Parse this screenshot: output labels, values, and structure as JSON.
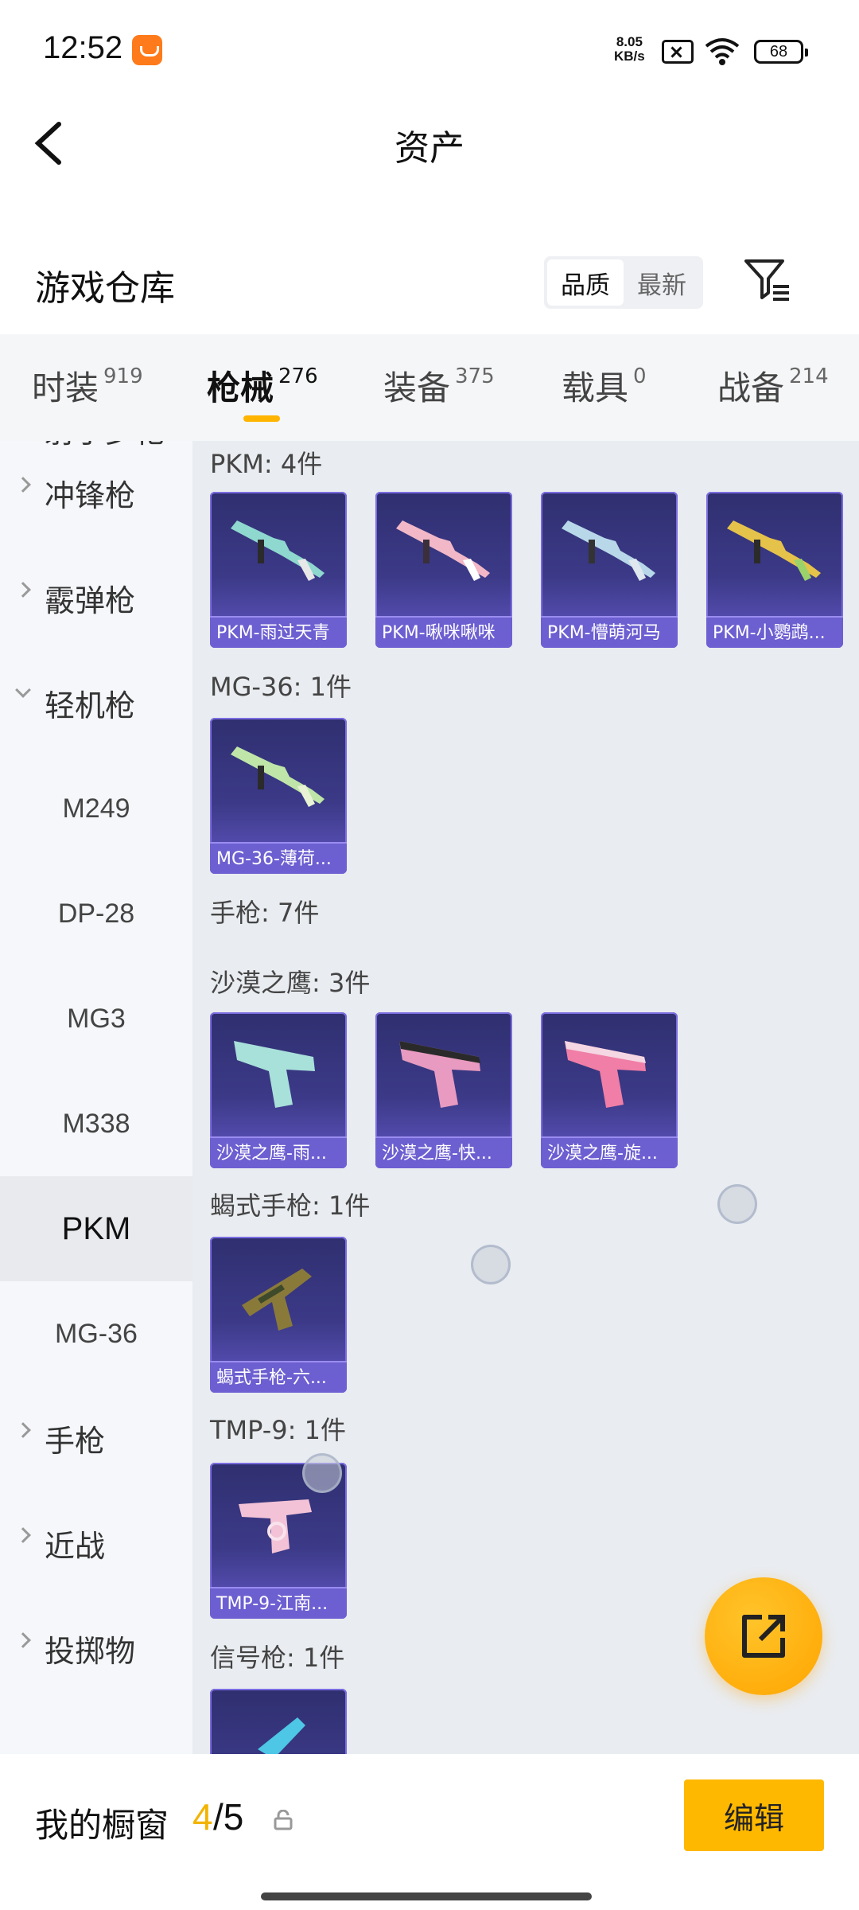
{
  "status_bar": {
    "time": "12:52",
    "net_speed_value": "8.05",
    "net_speed_unit": "KB/s",
    "battery": "68",
    "icons": [
      "app-notification-icon",
      "sim-off-icon",
      "wifi-icon",
      "battery-icon"
    ]
  },
  "header": {
    "title": "资产",
    "back_icon": "chevron-left-icon"
  },
  "warehouse": {
    "title": "游戏仓库",
    "sort_options": [
      {
        "label": "品质",
        "active": true
      },
      {
        "label": "最新",
        "active": false
      }
    ],
    "filter_icon": "filter-icon"
  },
  "tabs": [
    {
      "label": "时装",
      "count": "919",
      "active": false
    },
    {
      "label": "枪械",
      "count": "276",
      "active": true
    },
    {
      "label": "装备",
      "count": "375",
      "active": false
    },
    {
      "label": "载具",
      "count": "0",
      "active": false
    },
    {
      "label": "战备",
      "count": "214",
      "active": false
    }
  ],
  "sidebar": {
    "partial_top": "射手步枪",
    "groups": [
      {
        "label": "冲锋枪",
        "expanded": false
      },
      {
        "label": "霰弹枪",
        "expanded": false
      },
      {
        "label": "轻机枪",
        "expanded": true
      }
    ],
    "subitems": [
      {
        "label": "M249",
        "active": false
      },
      {
        "label": "DP-28",
        "active": false
      },
      {
        "label": "MG3",
        "active": false
      },
      {
        "label": "M338",
        "active": false
      },
      {
        "label": "PKM",
        "active": true
      },
      {
        "label": "MG-36",
        "active": false
      }
    ],
    "groups_after": [
      {
        "label": "手枪",
        "expanded": false
      },
      {
        "label": "近战",
        "expanded": false
      },
      {
        "label": "投掷物",
        "expanded": false
      }
    ]
  },
  "content": {
    "sections": [
      {
        "title": "PKM: 4件",
        "items": [
          "PKM-雨过天青",
          "PKM-啾咪啾咪",
          "PKM-懵萌河马",
          "PKM-小鹦鹉..."
        ]
      },
      {
        "title": "MG-36: 1件",
        "items": [
          "MG-36-薄荷..."
        ]
      },
      {
        "title": "手枪: 7件",
        "items": []
      },
      {
        "title": "沙漠之鹰: 3件",
        "items": [
          "沙漠之鹰-雨...",
          "沙漠之鹰-快...",
          "沙漠之鹰-旋..."
        ]
      },
      {
        "title": "蝎式手枪: 1件",
        "items": [
          "蝎式手枪-六..."
        ]
      },
      {
        "title": "TMP-9: 1件",
        "items": [
          "TMP-9-江南..."
        ]
      },
      {
        "title": "信号枪: 1件",
        "items": []
      }
    ],
    "colors": {
      "card_top": "#2f2f70",
      "card_bottom": "#6457c7",
      "card_label": "#6e60d2"
    }
  },
  "fab": {
    "icon": "share-external-icon",
    "color": "#ffb000"
  },
  "bottom_bar": {
    "label": "我的橱窗",
    "count_current": "4",
    "count_total": "/5",
    "lock_icon": "lock-icon",
    "edit_label": "编辑",
    "accent": "#ffb800"
  }
}
